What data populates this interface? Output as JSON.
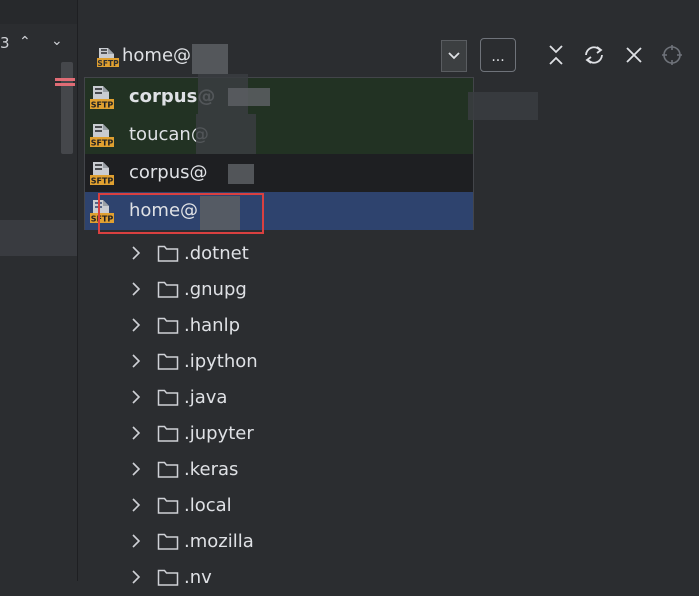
{
  "left_panel": {
    "label": "3",
    "up_glyph": "⌃",
    "down_glyph": "⌄"
  },
  "header": {
    "top_text": "─ ───",
    "connection_label": "home@",
    "more_label": "...",
    "icons": [
      "collapse-icon",
      "refresh-icon",
      "close-icon",
      "target-icon"
    ]
  },
  "dropdown": {
    "items": [
      {
        "label": "corpus@",
        "icon": "sftp-icon",
        "bold": true
      },
      {
        "label": "toucan@",
        "icon": "sftp-icon",
        "bold": false
      },
      {
        "label": "corpus@",
        "icon": "sftp-icon",
        "bold": false
      },
      {
        "label": "home@",
        "icon": "sftp-icon",
        "bold": false,
        "selected": true
      }
    ],
    "icon_text": "SFTP"
  },
  "tree": {
    "items": [
      {
        "label": ".dotnet"
      },
      {
        "label": ".gnupg"
      },
      {
        "label": ".hanlp"
      },
      {
        "label": ".ipython"
      },
      {
        "label": ".java"
      },
      {
        "label": ".jupyter"
      },
      {
        "label": ".keras"
      },
      {
        "label": ".local"
      },
      {
        "label": ".mozilla"
      },
      {
        "label": ".nv"
      }
    ]
  },
  "colors": {
    "background": "#2b2d30",
    "dropdown_bg": "#1e1f22",
    "selected_bg": "#2e436e",
    "green_bg": "#223223",
    "highlight": "#d94040",
    "sftp_icon": "#e0a030"
  }
}
